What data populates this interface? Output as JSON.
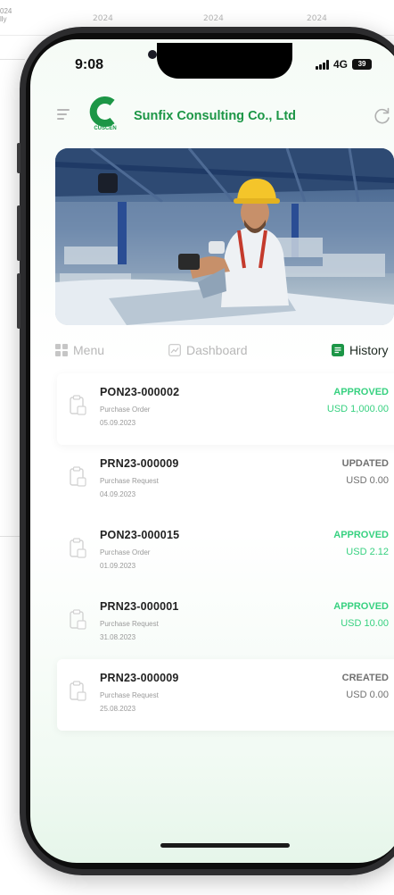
{
  "background": {
    "year_labels": [
      "2024",
      "2024",
      "2024"
    ],
    "left_labels": [
      "024",
      "lly"
    ]
  },
  "status_bar": {
    "time": "9:08",
    "network": "4G",
    "battery": "39"
  },
  "header": {
    "logo_text": "CUSCEN",
    "company_name": "Sunfix Consulting Co., Ltd",
    "menu_icon": "hamburger-icon",
    "refresh_icon": "refresh-icon"
  },
  "tabs": {
    "menu": "Menu",
    "dashboard": "Dashboard",
    "history": "History"
  },
  "colors": {
    "brand_green": "#1c9646",
    "approved_green": "#37d180",
    "neutral_gray": "#707070"
  },
  "history": [
    {
      "code": "PON23-000002",
      "type": "Purchase Order",
      "date": "05.09.2023",
      "status": "APPROVED",
      "amount": "USD 1,000.00"
    },
    {
      "code": "PRN23-000009",
      "type": "Purchase Request",
      "date": "04.09.2023",
      "status": "UPDATED",
      "amount": "USD 0.00"
    },
    {
      "code": "PON23-000015",
      "type": "Purchase Order",
      "date": "01.09.2023",
      "status": "APPROVED",
      "amount": "USD 2.12"
    },
    {
      "code": "PRN23-000001",
      "type": "Purchase Request",
      "date": "31.08.2023",
      "status": "APPROVED",
      "amount": "USD 10.00"
    },
    {
      "code": "PRN23-000009",
      "type": "Purchase Request",
      "date": "25.08.2023",
      "status": "CREATED",
      "amount": "USD 0.00"
    }
  ]
}
